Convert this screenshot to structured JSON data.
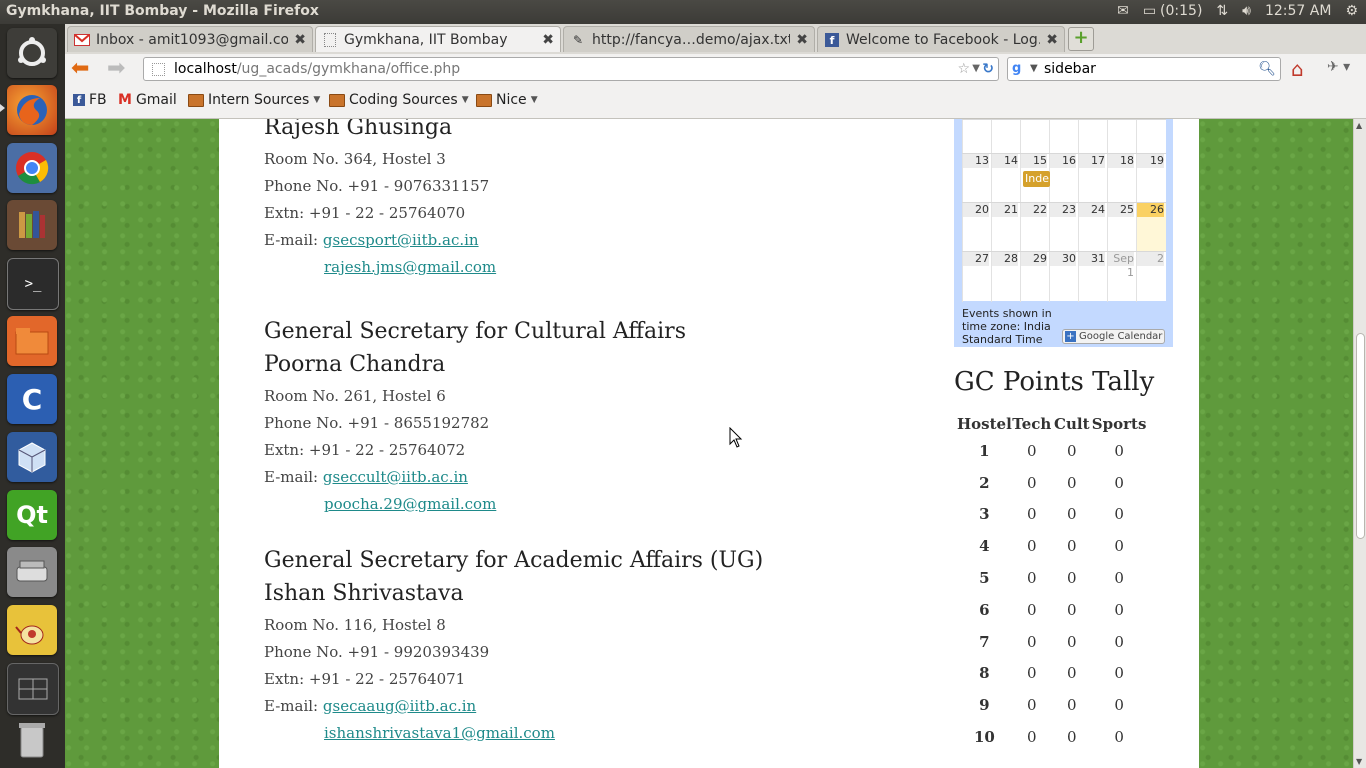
{
  "system": {
    "window_title": "Gymkhana, IIT Bombay - Mozilla Firefox",
    "battery": "(0:15)",
    "clock": "12:57 AM"
  },
  "browser": {
    "tabs": [
      {
        "label": "Inbox - amit1093@gmail.co…",
        "icon": "gmail-icon"
      },
      {
        "label": "Gymkhana, IIT Bombay",
        "icon": "page-icon"
      },
      {
        "label": "http://fancya…demo/ajax.txt",
        "icon": "pin-icon"
      },
      {
        "label": "Welcome to Facebook - Log…",
        "icon": "facebook-icon"
      }
    ],
    "url_host": "localhost",
    "url_path": "/ug_acads/gymkhana/office.php",
    "search_value": "sidebar",
    "bookmarks": [
      {
        "label": "FB"
      },
      {
        "label": "Gmail"
      },
      {
        "label": "Intern Sources"
      },
      {
        "label": "Coding Sources"
      },
      {
        "label": "Nice"
      }
    ]
  },
  "people": [
    {
      "post": "",
      "name": "Rajesh Ghusinga",
      "room": "Room No. 364, Hostel 3",
      "phone": "Phone No. +91 - 9076331157",
      "extn": "Extn: +91 - 22 - 25764070",
      "email_label": "E-mail:",
      "email1": "gsecsport@iitb.ac.in",
      "email2": "rajesh.jms@gmail.com"
    },
    {
      "post": "General Secretary for Cultural Affairs",
      "name": "Poorna Chandra",
      "room": "Room No. 261, Hostel 6",
      "phone": "Phone No. +91 - 8655192782",
      "extn": "Extn: +91 - 22 - 25764072",
      "email_label": "E-mail:",
      "email1": "gseccult@iitb.ac.in",
      "email2": "poocha.29@gmail.com"
    },
    {
      "post": "General Secretary for Academic Affairs (UG)",
      "name": "Ishan Shrivastava",
      "room": "Room No. 116, Hostel 8",
      "phone": "Phone No. +91 - 9920393439",
      "extn": "Extn: +91 - 22 - 25764071",
      "email_label": "E-mail:",
      "email1": "gsecaaug@iitb.ac.in",
      "email2": "ishanshrivastava1@gmail.com"
    }
  ],
  "calendar": {
    "weeks": [
      [
        "13",
        "14",
        "15",
        "16",
        "17",
        "18",
        "19"
      ],
      [
        "20",
        "21",
        "22",
        "23",
        "24",
        "25",
        "26"
      ],
      [
        "27",
        "28",
        "29",
        "30",
        "31",
        "Sep 1",
        "2"
      ]
    ],
    "event_label": "Inde",
    "footer": "Events shown in time zone: India Standard Time",
    "button_label": "Google Calendar"
  },
  "gc_tally": {
    "title": "GC Points Tally",
    "headers": [
      "Hostel",
      "Tech",
      "Cult",
      "Sports"
    ],
    "rows": [
      [
        "1",
        "0",
        "0",
        "0"
      ],
      [
        "2",
        "0",
        "0",
        "0"
      ],
      [
        "3",
        "0",
        "0",
        "0"
      ],
      [
        "4",
        "0",
        "0",
        "0"
      ],
      [
        "5",
        "0",
        "0",
        "0"
      ],
      [
        "6",
        "0",
        "0",
        "0"
      ],
      [
        "7",
        "0",
        "0",
        "0"
      ],
      [
        "8",
        "0",
        "0",
        "0"
      ],
      [
        "9",
        "0",
        "0",
        "0"
      ],
      [
        "10",
        "0",
        "0",
        "0"
      ]
    ]
  },
  "colors": {
    "link": "#1e8a8a",
    "calendar_frame": "#c3d9ff",
    "today": "#fad163",
    "event": "#d5a12c"
  }
}
